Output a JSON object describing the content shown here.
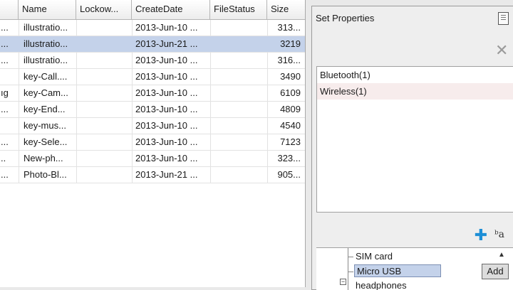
{
  "table": {
    "columns": [
      "",
      "Name",
      "Lockow...",
      "CreateDate",
      "FileStatus",
      "Size"
    ],
    "rows": [
      {
        "c0": "...",
        "name": "illustratio...",
        "lock": "",
        "date": "2013-Jun-10 ...",
        "status": "",
        "size": "313...",
        "selected": false
      },
      {
        "c0": "...",
        "name": "illustratio...",
        "lock": "",
        "date": "2013-Jun-21 ...",
        "status": "",
        "size": "3219",
        "selected": true
      },
      {
        "c0": "...",
        "name": "illustratio...",
        "lock": "",
        "date": "2013-Jun-10 ...",
        "status": "",
        "size": "316...",
        "selected": false
      },
      {
        "c0": "",
        "name": "key-Call....",
        "lock": "",
        "date": "2013-Jun-10 ...",
        "status": "",
        "size": "3490",
        "selected": false
      },
      {
        "c0": "ıg",
        "name": "key-Cam...",
        "lock": "",
        "date": "2013-Jun-10 ...",
        "status": "",
        "size": "6109",
        "selected": false
      },
      {
        "c0": "...",
        "name": "key-End...",
        "lock": "",
        "date": "2013-Jun-10 ...",
        "status": "",
        "size": "4809",
        "selected": false
      },
      {
        "c0": "",
        "name": "key-mus...",
        "lock": "",
        "date": "2013-Jun-10 ...",
        "status": "",
        "size": "4540",
        "selected": false
      },
      {
        "c0": "...",
        "name": "key-Sele...",
        "lock": "",
        "date": "2013-Jun-10 ...",
        "status": "",
        "size": "7123",
        "selected": false
      },
      {
        "c0": "..",
        "name": "New-ph...",
        "lock": "",
        "date": "2013-Jun-10 ...",
        "status": "",
        "size": "323...",
        "selected": false
      },
      {
        "c0": "...",
        "name": "Photo-Bl...",
        "lock": "",
        "date": "2013-Jun-21 ...",
        "status": "",
        "size": "905...",
        "selected": false
      }
    ]
  },
  "properties": {
    "title": "Set Properties",
    "items": [
      "Bluetooth(1)",
      "Wireless(1)"
    ],
    "sort_label": "ᵇa",
    "tree": [
      "SIM card",
      "Micro USB",
      "headphones"
    ],
    "add_label": "Add"
  },
  "colors": {
    "selection": "#c4d2ea",
    "accent_plus": "#1e8fd6"
  }
}
